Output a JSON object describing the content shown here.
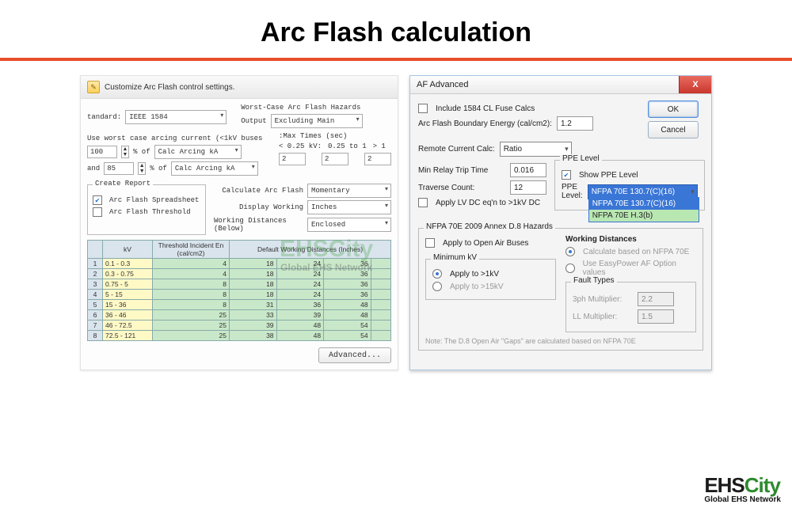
{
  "title": "Arc Flash calculation",
  "watermark": {
    "brand_left": "EHS",
    "brand_right": "City",
    "sub": "Global EHS Network"
  },
  "left": {
    "header": "Customize Arc Flash control settings.",
    "standard_lbl": "tandard:",
    "standard_val": "IEEE 1584",
    "wc_heading": "Worst-Case Arc Flash Hazards",
    "output_lbl": "Output",
    "output_val": "Excluding Main",
    "uwc_line": "Use worst case arcing current (<1kV buses",
    "max_times": ":Max Times (sec)",
    "pct_of": "% of",
    "calc_arcing": "Calc Arcing kA",
    "and": "and",
    "num100": "100",
    "num85": "85",
    "lt025": "< 0.25 kV:",
    "range025": "0.25 to 1",
    "gt1": "> 1",
    "two_a": "2",
    "two_b": "2",
    "two_c": "2",
    "create_report": "Create Report",
    "cb_spreadsheet": "Arc Flash Spreadsheet",
    "cb_threshold": "Arc Flash Threshold",
    "calc_af_lbl": "Calculate Arc Flash",
    "calc_af_val": "Momentary",
    "disp_work_lbl": "Display Working",
    "disp_work_val": "Inches",
    "wd_below_lbl": "Working Distances (Below)",
    "wd_below_val": "Enclosed",
    "tbl_hdr_kv": "kV",
    "tbl_hdr_thr": "Threshold Incident En (cal/cm2)",
    "tbl_hdr_wd": "Default Working Distances (Inches)",
    "rows": [
      {
        "n": "1",
        "kv": "0.1 - 0.3",
        "thr": "4",
        "wd": [
          "18",
          "24",
          "36",
          ""
        ]
      },
      {
        "n": "2",
        "kv": "0.3 - 0.75",
        "thr": "4",
        "wd": [
          "18",
          "24",
          "36",
          ""
        ]
      },
      {
        "n": "3",
        "kv": "0.75 - 5",
        "thr": "8",
        "wd": [
          "18",
          "24",
          "36",
          ""
        ]
      },
      {
        "n": "4",
        "kv": "5 - 15",
        "thr": "8",
        "wd": [
          "18",
          "24",
          "36",
          ""
        ]
      },
      {
        "n": "5",
        "kv": "15 - 36",
        "thr": "8",
        "wd": [
          "31",
          "36",
          "48",
          ""
        ]
      },
      {
        "n": "6",
        "kv": "36 - 46",
        "thr": "25",
        "wd": [
          "33",
          "39",
          "48",
          ""
        ]
      },
      {
        "n": "7",
        "kv": "46 - 72.5",
        "thr": "25",
        "wd": [
          "39",
          "48",
          "54",
          ""
        ]
      },
      {
        "n": "8",
        "kv": "72.5 - 121",
        "thr": "25",
        "wd": [
          "38",
          "48",
          "54",
          ""
        ]
      }
    ],
    "advanced_btn": "Advanced..."
  },
  "right": {
    "title": "AF Advanced",
    "ok": "OK",
    "cancel": "Cancel",
    "incl_1584": "Include 1584 CL Fuse Calcs",
    "afb_lbl": "Arc Flash Boundary Energy (cal/cm2):",
    "afb_val": "1.2",
    "remote_lbl": "Remote Current Calc:",
    "remote_val": "Ratio",
    "min_relay_lbl": "Min Relay Trip Time",
    "min_relay_val": "0.016",
    "traverse_lbl": "Traverse Count:",
    "traverse_val": "12",
    "apply_lv": "Apply LV DC eq'n to >1kV DC",
    "ppe_legend": "PPE Level",
    "show_ppe": "Show PPE Level",
    "ppe_lbl": "PPE Level:",
    "ppe_sel": "NFPA 70E 130.7(C)(16)",
    "ppe_opt1": "NFPA 70E 130.7(C)(16)",
    "ppe_opt2": "NFPA 70E H.3(b)",
    "annex_legend": "NFPA 70E 2009 Annex D.8 Hazards",
    "apply_open_air": "Apply to Open Air Buses",
    "wd_legend": "Working Distances",
    "wd_r1": "Calculate based on NFPA 70E",
    "wd_r2": "Use EasyPower AF Option values",
    "minkv_legend": "Minimum kV",
    "minkv_r1": "Apply to >1kV",
    "minkv_r2": "Apply to >15kV",
    "ft_legend": "Fault Types",
    "ft_3ph": "3ph Multiplier:",
    "ft_3ph_val": "2.2",
    "ft_ll": "LL Multiplier:",
    "ft_ll_val": "1.5",
    "note": "Note: The D.8 Open Air \"Gaps\" are calculated based on NFPA 70E"
  }
}
